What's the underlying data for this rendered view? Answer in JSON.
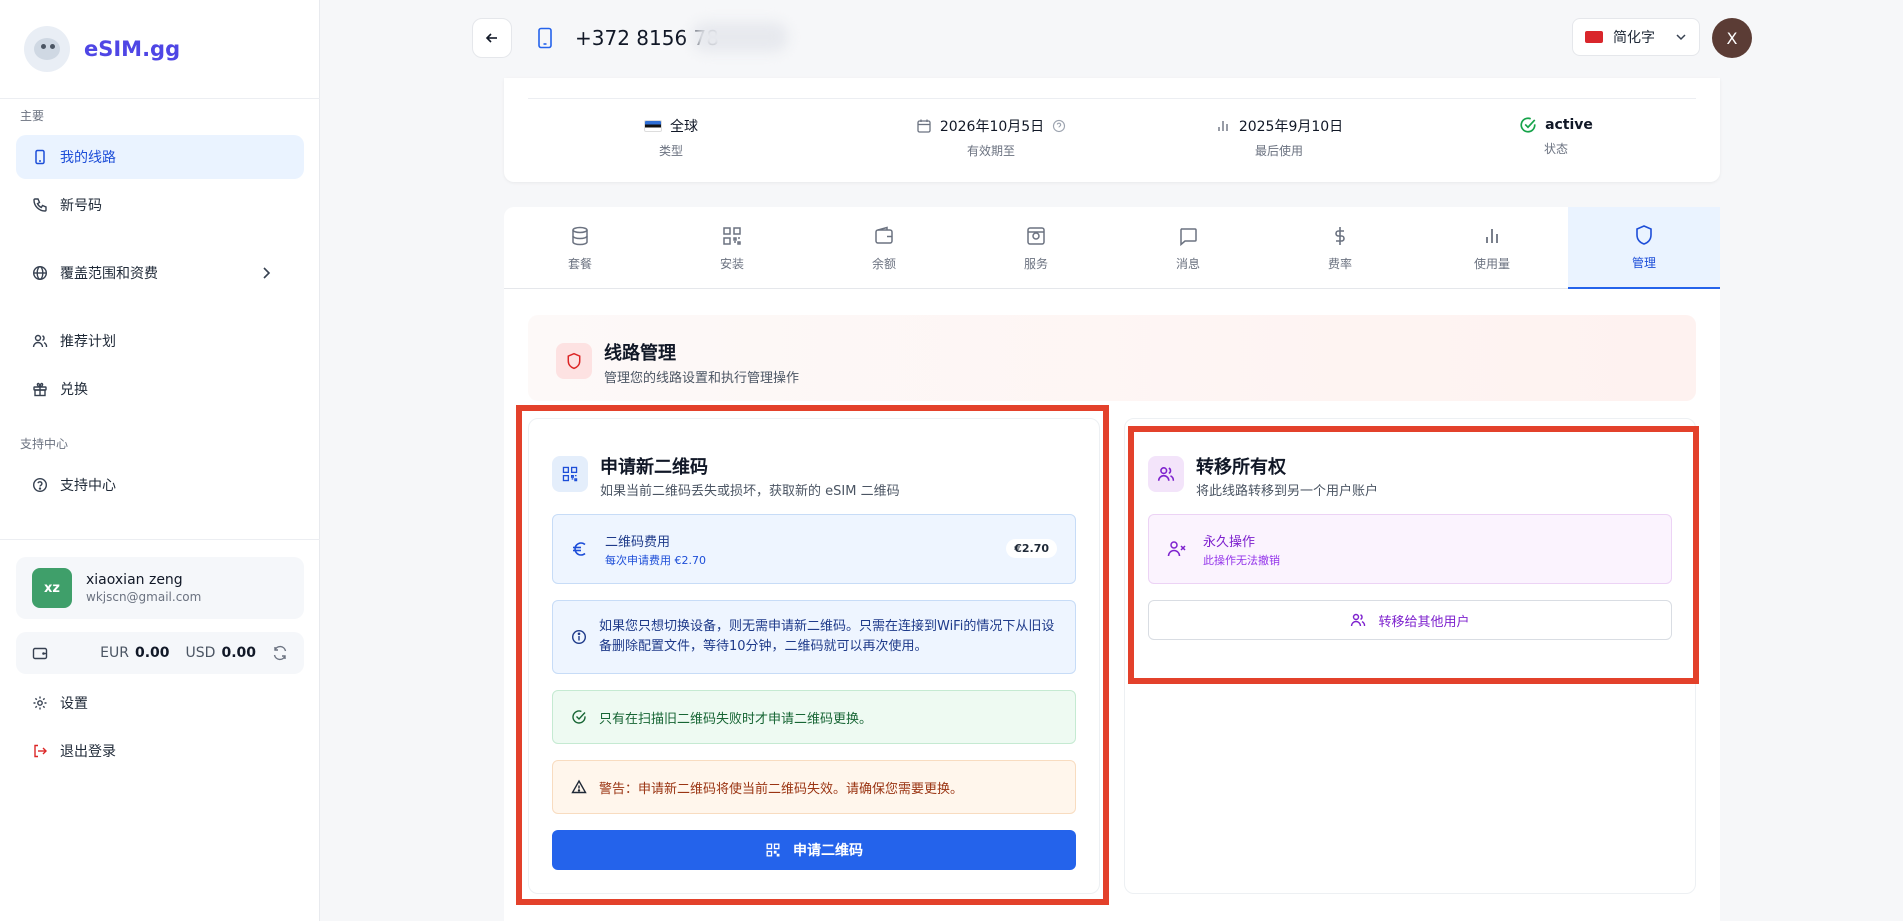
{
  "brand": {
    "name": "eSIM.gg"
  },
  "sidebar": {
    "section_main": "主要",
    "items": [
      {
        "label": "我的线路"
      },
      {
        "label": "新号码"
      },
      {
        "label": "覆盖范围和资费"
      },
      {
        "label": "推荐计划"
      },
      {
        "label": "兑换"
      }
    ],
    "section_support": "支持中心",
    "support_item": "支持中心",
    "user": {
      "initials": "xz",
      "name": "xiaoxian zeng",
      "email": "wkjscn@gmail.com"
    },
    "balance": {
      "eur_label": "EUR",
      "eur_value": "0.00",
      "usd_label": "USD",
      "usd_value": "0.00"
    },
    "settings": "设置",
    "logout": "退出登录"
  },
  "header": {
    "phone_number": "+372 8156 78",
    "language": "简化字",
    "avatar_initial": "X"
  },
  "info": {
    "type_value": "全球",
    "type_label": "类型",
    "expiry_value": "2026年10月5日",
    "expiry_label": "有效期至",
    "last_used_value": "2025年9月10日",
    "last_used_label": "最后使用",
    "status_value": "active",
    "status_label": "状态"
  },
  "tabs": [
    {
      "label": "套餐"
    },
    {
      "label": "安装"
    },
    {
      "label": "余额"
    },
    {
      "label": "服务"
    },
    {
      "label": "消息"
    },
    {
      "label": "费率"
    },
    {
      "label": "使用量"
    },
    {
      "label": "管理"
    }
  ],
  "management": {
    "title": "线路管理",
    "subtitle": "管理您的线路设置和执行管理操作"
  },
  "qr_panel": {
    "title": "申请新二维码",
    "subtitle": "如果当前二维码丢失或损坏，获取新的 eSIM 二维码",
    "fee_title": "二维码费用",
    "fee_sub": "每次申请费用 €2.70",
    "fee_price": "€2.70",
    "info_text": "如果您只想切换设备，则无需申请新二维码。只需在连接到WiFi的情况下从旧设备删除配置文件，等待10分钟，二维码就可以再次使用。",
    "ok_text": "只有在扫描旧二维码失败时才申请二维码更换。",
    "warn_text": "警告：申请新二维码将使当前二维码失效。请确保您需要更换。",
    "button": "申请二维码"
  },
  "transfer_panel": {
    "title": "转移所有权",
    "subtitle": "将此线路转移到另一个用户账户",
    "perm_title": "永久操作",
    "perm_sub": "此操作无法撤销",
    "button": "转移给其他用户"
  },
  "colors": {
    "accent": "#2463eb",
    "highlight_frame": "#e3412b"
  }
}
